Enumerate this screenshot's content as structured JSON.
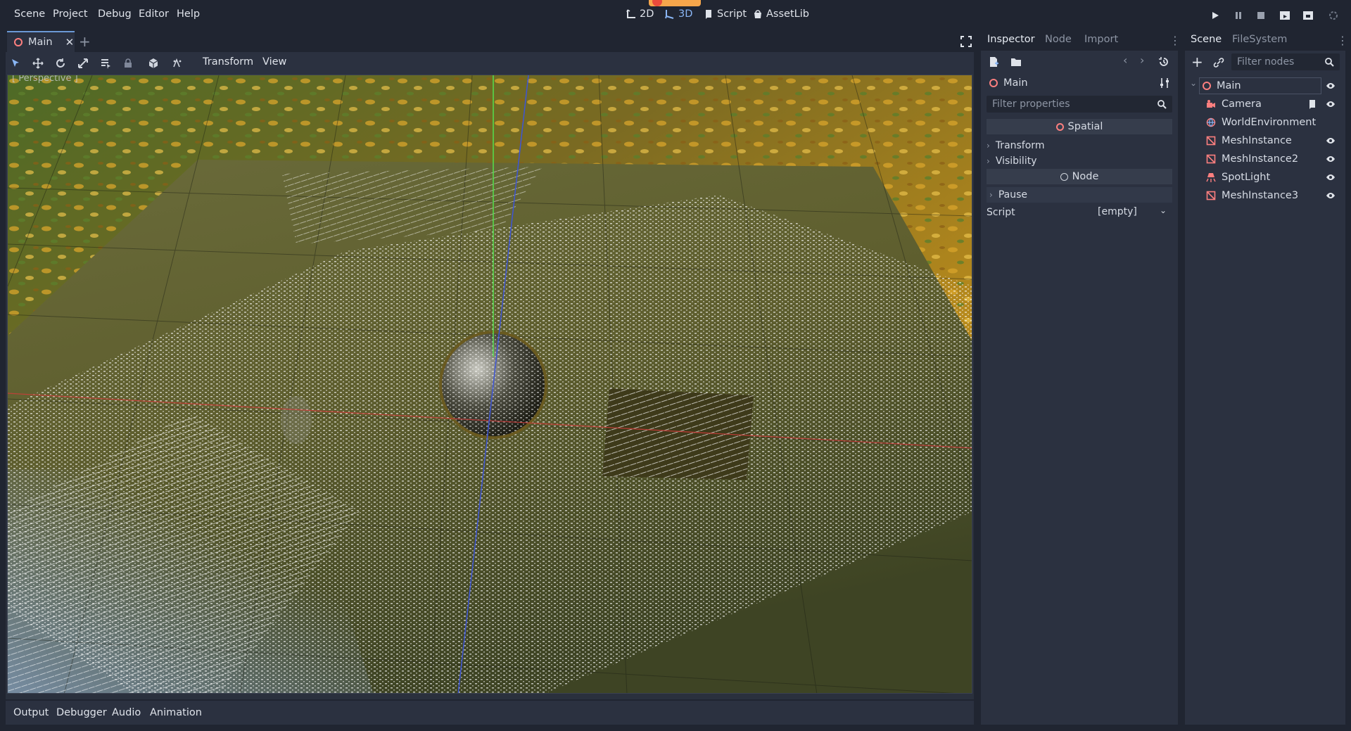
{
  "menu": {
    "items": [
      "Scene",
      "Project",
      "Debug",
      "Editor",
      "Help"
    ]
  },
  "workspaces": {
    "2d": "2D",
    "3d": "3D",
    "script": "Script",
    "assetlib": "AssetLib"
  },
  "editor_tabs": {
    "main": "Main"
  },
  "viewport_toolbar": {
    "transform": "Transform",
    "view": "View"
  },
  "viewport": {
    "label": "[ Perspective ]"
  },
  "bottom_panel": {
    "tabs": [
      "Output",
      "Debugger",
      "Audio",
      "Animation"
    ]
  },
  "inspector": {
    "tabs": [
      "Inspector",
      "Node",
      "Import"
    ],
    "object_name": "Main",
    "filter_placeholder": "Filter properties",
    "section_spatial": "Spatial",
    "transform": "Transform",
    "visibility": "Visibility",
    "section_node": "Node",
    "pause": "Pause",
    "script_label": "Script",
    "script_value": "[empty]"
  },
  "scene": {
    "tabs": [
      "Scene",
      "FileSystem"
    ],
    "filter_placeholder": "Filter nodes",
    "nodes": [
      "Main",
      "Camera",
      "WorldEnvironment",
      "MeshInstance",
      "MeshInstance2",
      "SpotLight",
      "MeshInstance3"
    ]
  },
  "colors": {
    "accent": "#8ab6f5",
    "node_spatial": "#fc7f7f",
    "background": "#202531",
    "panel": "#2b3140"
  }
}
